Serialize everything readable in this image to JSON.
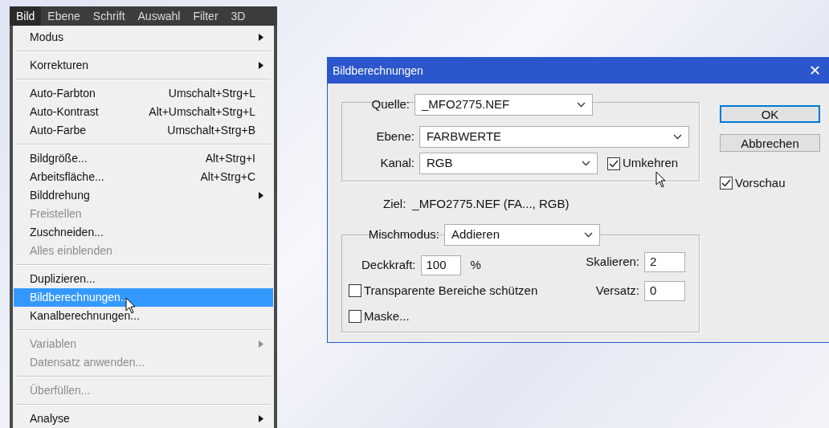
{
  "menu_bar": [
    {
      "label": "Bild",
      "selected": true
    },
    {
      "label": "Ebene",
      "selected": false
    },
    {
      "label": "Schrift",
      "selected": false
    },
    {
      "label": "Auswahl",
      "selected": false
    },
    {
      "label": "Filter",
      "selected": false
    },
    {
      "label": "3D",
      "selected": false
    }
  ],
  "menu": [
    {
      "kind": "item",
      "label": "Modus",
      "submenu": true,
      "disabled": false,
      "selected": false
    },
    {
      "kind": "separator"
    },
    {
      "kind": "item",
      "label": "Korrekturen",
      "submenu": true,
      "disabled": false,
      "selected": false
    },
    {
      "kind": "separator"
    },
    {
      "kind": "item",
      "label": "Auto-Farbton",
      "shortcut": "Umschalt+Strg+L",
      "submenu": false,
      "disabled": false,
      "selected": false
    },
    {
      "kind": "item",
      "label": "Auto-Kontrast",
      "shortcut": "Alt+Umschalt+Strg+L",
      "submenu": false,
      "disabled": false,
      "selected": false
    },
    {
      "kind": "item",
      "label": "Auto-Farbe",
      "shortcut": "Umschalt+Strg+B",
      "submenu": false,
      "disabled": false,
      "selected": false
    },
    {
      "kind": "separator"
    },
    {
      "kind": "item",
      "label": "Bildgröße...",
      "shortcut": "Alt+Strg+I",
      "submenu": false,
      "disabled": false,
      "selected": false
    },
    {
      "kind": "item",
      "label": "Arbeitsfläche...",
      "shortcut": "Alt+Strg+C",
      "submenu": false,
      "disabled": false,
      "selected": false
    },
    {
      "kind": "item",
      "label": "Bilddrehung",
      "submenu": true,
      "disabled": false,
      "selected": false
    },
    {
      "kind": "item",
      "label": "Freistellen",
      "submenu": false,
      "disabled": true,
      "selected": false
    },
    {
      "kind": "item",
      "label": "Zuschneiden...",
      "submenu": false,
      "disabled": false,
      "selected": false
    },
    {
      "kind": "item",
      "label": "Alles einblenden",
      "submenu": false,
      "disabled": true,
      "selected": false
    },
    {
      "kind": "separator"
    },
    {
      "kind": "item",
      "label": "Duplizieren...",
      "submenu": false,
      "disabled": false,
      "selected": false
    },
    {
      "kind": "item",
      "label": "Bildberechnungen...",
      "submenu": false,
      "disabled": false,
      "selected": true
    },
    {
      "kind": "item",
      "label": "Kanalberechnungen...",
      "submenu": false,
      "disabled": false,
      "selected": false
    },
    {
      "kind": "separator"
    },
    {
      "kind": "item",
      "label": "Variablen",
      "submenu": true,
      "disabled": true,
      "selected": false
    },
    {
      "kind": "item",
      "label": "Datensatz anwenden...",
      "submenu": false,
      "disabled": true,
      "selected": false
    },
    {
      "kind": "separator"
    },
    {
      "kind": "item",
      "label": "Überfüllen...",
      "submenu": false,
      "disabled": true,
      "selected": false
    },
    {
      "kind": "separator"
    },
    {
      "kind": "item",
      "label": "Analyse",
      "submenu": true,
      "disabled": false,
      "selected": false
    }
  ],
  "dialog": {
    "title": "Bildberechnungen",
    "close": "✕",
    "source": {
      "quelle": {
        "label": "Quelle:",
        "value": "_MFO2775.NEF"
      },
      "ebene": {
        "label": "Ebene:",
        "value": "FARBWERTE"
      },
      "kanal": {
        "label": "Kanal:",
        "value": "RGB"
      },
      "invert": {
        "label": "Umkehren",
        "checked": true
      }
    },
    "target": {
      "label": "Ziel:",
      "value": "_MFO2775.NEF (FA..., RGB)"
    },
    "blending": {
      "mode": {
        "label": "Mischmodus:",
        "value": "Addieren"
      },
      "opacity": {
        "label": "Deckkraft:",
        "value": "100",
        "unit": "%"
      },
      "scale": {
        "label": "Skalieren:",
        "value": "2"
      },
      "offset": {
        "label": "Versatz:",
        "value": "0"
      },
      "preserve_transparency": {
        "label": "Transparente Bereiche schützen",
        "checked": false
      },
      "mask": {
        "label": "Maske...",
        "checked": false
      }
    },
    "buttons": [
      {
        "label": "OK",
        "default": true
      },
      {
        "label": "Abbrechen",
        "default": false
      }
    ],
    "preview": {
      "label": "Vorschau",
      "checked": true
    }
  }
}
